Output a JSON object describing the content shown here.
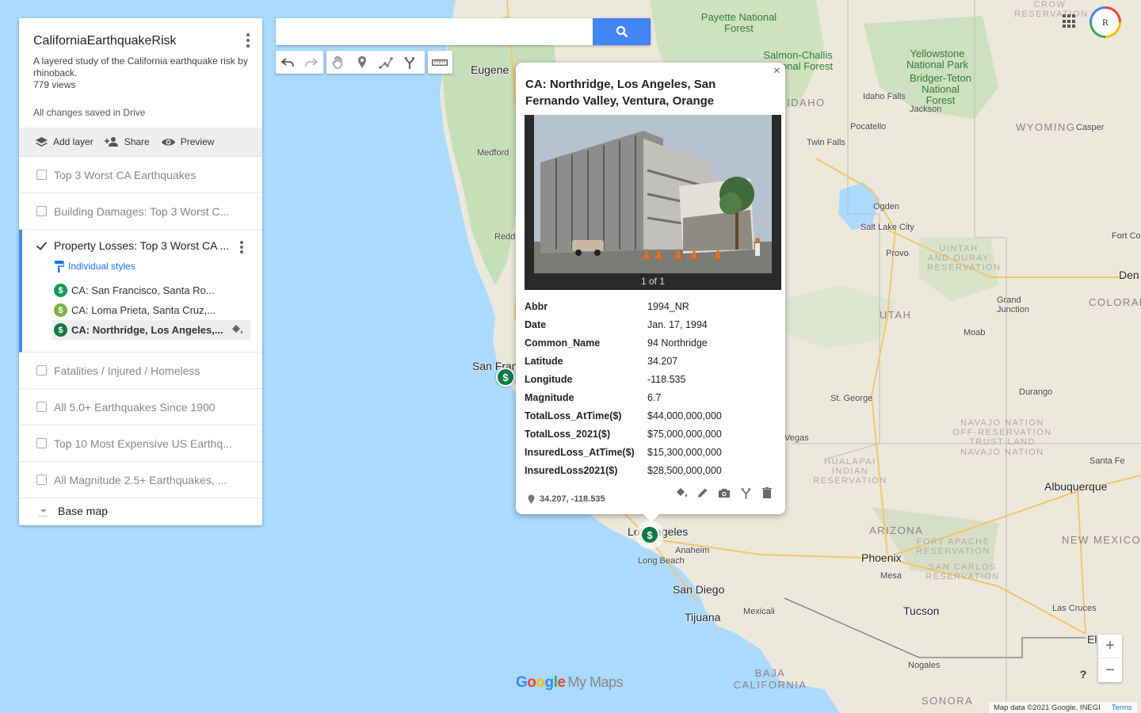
{
  "map": {
    "title": "CaliforniaEarthquakeRisk",
    "description": "A layered study of the California earthquake risk by rhinoback.",
    "views": "779 views",
    "save_status": "All changes saved in Drive"
  },
  "toolbar": {
    "add_layer": "Add layer",
    "share": "Share",
    "preview": "Preview"
  },
  "layers": [
    {
      "name": "Top 3 Worst CA Earthquakes",
      "checked": false
    },
    {
      "name": "Building Damages: Top 3 Worst C...",
      "checked": false
    },
    {
      "name": "Property Losses: Top 3 Worst CA ...",
      "checked": true
    },
    {
      "name": "Fatalities / Injured / Homeless",
      "checked": false
    },
    {
      "name": "All 5.0+ Earthquakes Since 1900",
      "checked": false
    },
    {
      "name": "Top 10 Most Expensive US Earthq...",
      "checked": false
    },
    {
      "name": "All Magnitude 2.5+ Earthquakes, ...",
      "checked": false
    }
  ],
  "active_layer": {
    "style_label": "Individual styles",
    "features": [
      {
        "label": "CA: San Francisco, Santa Ro...",
        "icon_color": "#0f9d58"
      },
      {
        "label": "CA: Loma Prieta, Santa Cruz,...",
        "icon_color": "#7cb342"
      },
      {
        "label": "CA: Northridge, Los Angeles,...",
        "icon_color": "#0b7a43"
      }
    ]
  },
  "base_map": "Base map",
  "search": {
    "placeholder": ""
  },
  "popup": {
    "title": "CA: Northridge, Los Angeles, San Fernando Valley, Ventura, Orange",
    "image_counter": "1 of 1",
    "attributes": [
      {
        "key": "Abbr",
        "value": "1994_NR"
      },
      {
        "key": "Date",
        "value": "Jan. 17, 1994"
      },
      {
        "key": "Common_Name",
        "value": "94 Northridge"
      },
      {
        "key": "Latitude",
        "value": "34.207"
      },
      {
        "key": "Longitude",
        "value": "-118.535"
      },
      {
        "key": "Magnitude",
        "value": "6.7"
      },
      {
        "key": "TotalLoss_AtTime($)",
        "value": "$44,000,000,000"
      },
      {
        "key": "TotalLoss_2021($)",
        "value": "$75,000,000,000"
      },
      {
        "key": "InsuredLoss_AtTime($)",
        "value": "$15,300,000,000"
      },
      {
        "key": "InsuredLoss2021($)",
        "value": "$28,500,000,000"
      }
    ],
    "coordinates": "34.207, -118.535",
    "close": "×"
  },
  "markers": {
    "symbol": "$"
  },
  "map_labels": {
    "cities": [
      "Eugene",
      "Medford",
      "Redd",
      "San Fran",
      "Los Angeles",
      "Anaheim",
      "Long Beach",
      "San Diego",
      "Tijuana",
      "Mexicali",
      "Phoenix",
      "Mesa",
      "Tucson",
      "Albuquerque",
      "Santa Fe",
      "Salt Lake City",
      "Provo",
      "Ogden",
      "Pocatello",
      "Idaho Falls",
      "Jackson",
      "Casper",
      "Fort Co",
      "Den",
      "Grand Junction",
      "Moab",
      "St. George",
      "Durango",
      "Las Cruces",
      "El P",
      "Nogales",
      "Twin Falls",
      "Vegas"
    ],
    "states": [
      "IDAHO",
      "WYOMING",
      "UTAH",
      "COLORAD",
      "ARIZONA",
      "NEW MEXICO",
      "BAJA CALIFORNIA",
      "SONORA"
    ],
    "forests": [
      "Payette National Forest",
      "Salmon-Challis National Forest",
      "Yellowstone National Park",
      "Bridger-Teton National Forest"
    ],
    "reservations": [
      "CROW RESERVATION",
      "UINTAH AND OURAY RESERVATION",
      "NAVAJO NATION OFF-RESERVATION TRUST LAND",
      "NAVAJO NATION",
      "HUALAPAI INDIAN RESERVATION",
      "FORT APACHE RESERVATION",
      "SAN CARLOS RESERVATION"
    ]
  },
  "branding": {
    "google": "Google",
    "mymaps": "My Maps"
  },
  "attribution": {
    "text": "Map data ©2021 Google, INEGI",
    "terms": "Terms"
  },
  "controls": {
    "zoom_in": "+",
    "zoom_out": "−",
    "help": "?"
  },
  "account": {
    "initial": "R"
  },
  "colors": {
    "accent": "#4285f4",
    "marker": "#0b7a43",
    "water": "#aadaff",
    "land": "#e8e4d8"
  }
}
